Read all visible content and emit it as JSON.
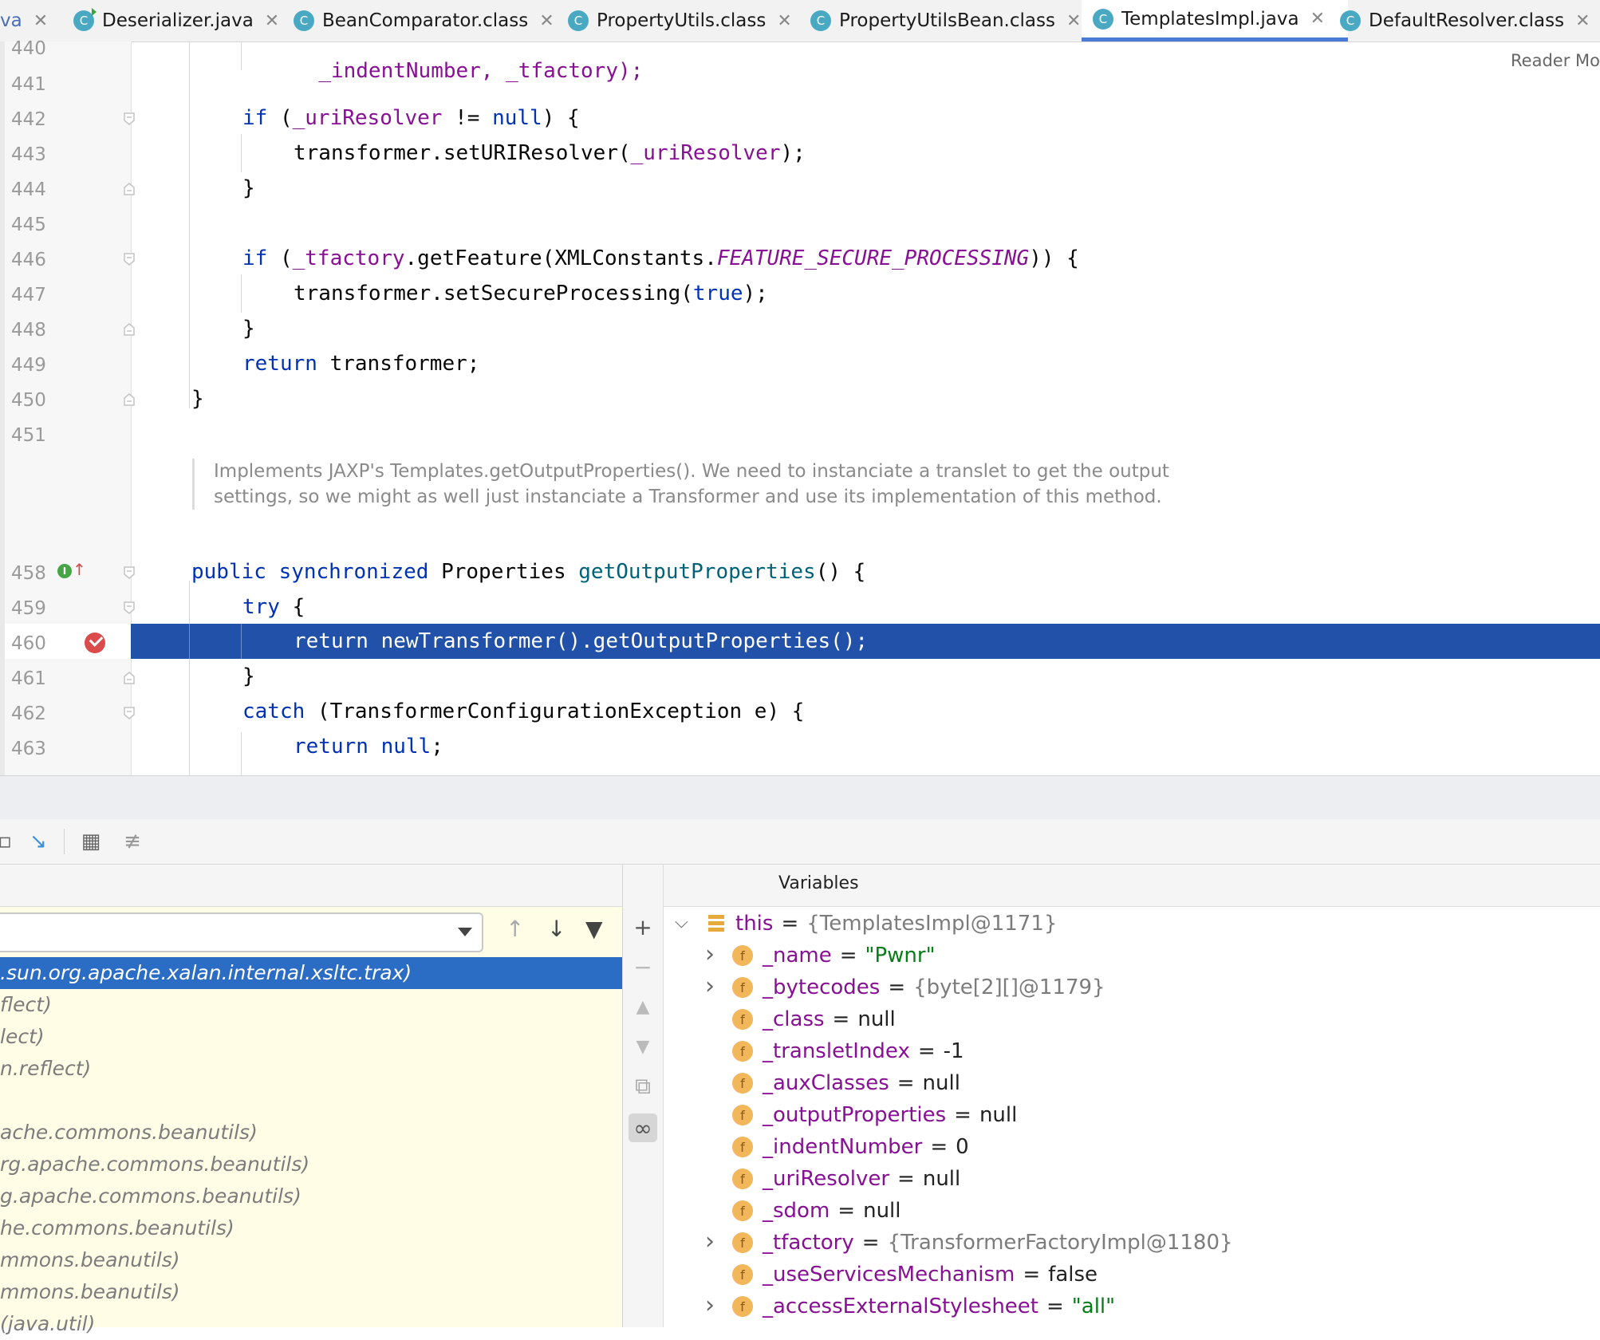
{
  "tabs": [
    {
      "label": "va",
      "icon": "java-class-icon",
      "closable": true,
      "active": false
    },
    {
      "label": "Deserializer.java",
      "icon": "java-class-run-icon",
      "closable": true,
      "active": false
    },
    {
      "label": "BeanComparator.class",
      "icon": "class-file-icon",
      "closable": true,
      "active": false
    },
    {
      "label": "PropertyUtils.class",
      "icon": "class-file-icon",
      "closable": true,
      "active": false
    },
    {
      "label": "PropertyUtilsBean.class",
      "icon": "class-file-icon",
      "closable": true,
      "active": false
    },
    {
      "label": "TemplatesImpl.java",
      "icon": "java-class-icon",
      "closable": true,
      "active": true
    },
    {
      "label": "DefaultResolver.class",
      "icon": "class-file-icon",
      "closable": true,
      "active": false
    }
  ],
  "reader_mode": "Reader Mo",
  "editor": {
    "line_numbers": [
      "440",
      "441",
      "442",
      "443",
      "444",
      "445",
      "446",
      "447",
      "448",
      "449",
      "450",
      "451",
      "458",
      "459",
      "460",
      "461",
      "462",
      "463"
    ],
    "doc_comment": "Implements JAXP's Templates.getOutputProperties(). We need to instanciate a translet to get the output settings, so we might as well just instanciate a Transformer and use its implementation of this method.",
    "execution_line": "460",
    "lines": {
      "l440": {
        "text": "_indentNumber, _tfactory);"
      },
      "l442": {
        "kw": "if",
        "open": " (",
        "field": "_uriResolver",
        "op": " != ",
        "kw2": "null",
        "close": ") {"
      },
      "l443": {
        "pre": "transformer.setURIResolver(",
        "field": "_uriResolver",
        "post": ");"
      },
      "l444": {
        "text": "}"
      },
      "l446": {
        "kw": "if",
        "open": " (",
        "field": "_tfactory",
        "call": ".getFeature(XMLConstants.",
        "const": "FEATURE_SECURE_PROCESSING",
        "close": ")) {"
      },
      "l447": {
        "pre": "transformer.setSecureProcessing(",
        "kw": "true",
        "post": ");"
      },
      "l448": {
        "text": "}"
      },
      "l449": {
        "kw": "return",
        "post": " transformer;"
      },
      "l450": {
        "text": "}"
      },
      "l458": {
        "kw": "public synchronized",
        "type": " Properties ",
        "meth": "getOutputProperties",
        "post": "() {"
      },
      "l459": {
        "kw": "try",
        "post": " {"
      },
      "l460": {
        "text": "return newTransformer().getOutputProperties();"
      },
      "l461": {
        "text": "}"
      },
      "l462": {
        "kw": "catch",
        "post": " (TransformerConfigurationException e) {"
      },
      "l463": {
        "kw": "return",
        "kw2": "null",
        "post": ";"
      }
    }
  },
  "frames": [
    ".sun.org.apache.xalan.internal.xsltc.trax)",
    "flect)",
    "lect)",
    "n.reflect)",
    "",
    "ache.commons.beanutils)",
    "rg.apache.commons.beanutils)",
    "g.apache.commons.beanutils)",
    "he.commons.beanutils)",
    "mmons.beanutils)",
    "mmons.beanutils)",
    "(java.util)"
  ],
  "variables_title": "Variables",
  "variables": [
    {
      "name": "this",
      "value": "{TemplatesImpl@1171}",
      "kind": "obj",
      "expand": "expanded",
      "icon": "this"
    },
    {
      "name": "_name",
      "value": "\"Pwnr\"",
      "kind": "str",
      "expand": "collapsed",
      "icon": "field"
    },
    {
      "name": "_bytecodes",
      "value": "{byte[2][]@1179}",
      "kind": "obj",
      "expand": "collapsed",
      "icon": "field"
    },
    {
      "name": "_class",
      "value": "null",
      "kind": "val",
      "expand": "none",
      "icon": "field"
    },
    {
      "name": "_transletIndex",
      "value": "-1",
      "kind": "val",
      "expand": "none",
      "icon": "field"
    },
    {
      "name": "_auxClasses",
      "value": "null",
      "kind": "val",
      "expand": "none",
      "icon": "field"
    },
    {
      "name": "_outputProperties",
      "value": "null",
      "kind": "val",
      "expand": "none",
      "icon": "field"
    },
    {
      "name": "_indentNumber",
      "value": "0",
      "kind": "val",
      "expand": "none",
      "icon": "field"
    },
    {
      "name": "_uriResolver",
      "value": "null",
      "kind": "val",
      "expand": "none",
      "icon": "field"
    },
    {
      "name": "_sdom",
      "value": "null",
      "kind": "val",
      "expand": "none",
      "icon": "field"
    },
    {
      "name": "_tfactory",
      "value": "{TransformerFactoryImpl@1180}",
      "kind": "obj",
      "expand": "collapsed",
      "icon": "field"
    },
    {
      "name": "_useServicesMechanism",
      "value": "false",
      "kind": "val",
      "expand": "none",
      "icon": "field"
    },
    {
      "name": "_accessExternalStylesheet",
      "value": "\"all\"",
      "kind": "str",
      "expand": "collapsed",
      "icon": "field"
    }
  ],
  "colors": {
    "keyword": "#0033b3",
    "field": "#871094",
    "method": "#00627a",
    "string": "#067d17",
    "execution_line": "#2151a8",
    "selected_frame": "#2b6cc4",
    "frames_background": "#fffde6"
  }
}
